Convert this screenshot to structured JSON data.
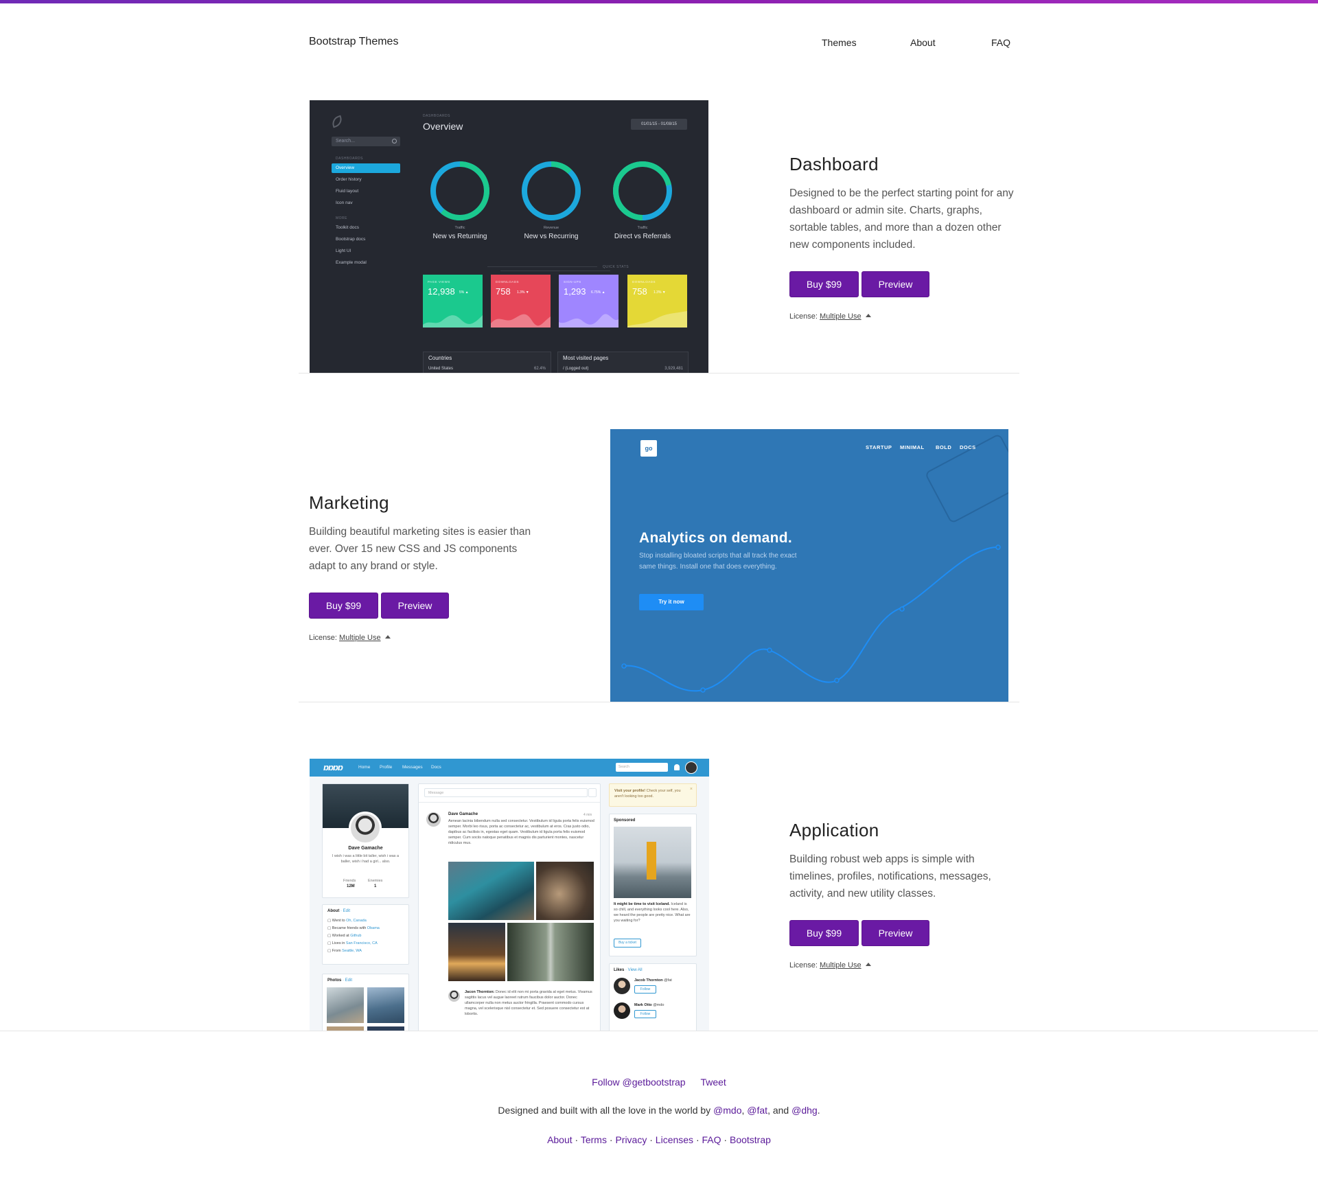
{
  "header": {
    "brand": "Bootstrap Themes",
    "nav": [
      "Themes",
      "About",
      "FAQ"
    ]
  },
  "themes": [
    {
      "name": "Dashboard",
      "description": "Designed to be the perfect starting point for any dashboard or admin site. Charts, graphs, sortable tables, and more than a dozen other new components included.",
      "buy_label": "Buy $99",
      "preview_label": "Preview",
      "license_label": "License:",
      "license_value": "Multiple Use"
    },
    {
      "name": "Marketing",
      "description": "Building beautiful marketing sites is easier than ever. Over 15 new CSS and JS components adapt to any brand or style.",
      "buy_label": "Buy $99",
      "preview_label": "Preview",
      "license_label": "License:",
      "license_value": "Multiple Use"
    },
    {
      "name": "Application",
      "description": "Building robust web apps is simple with timelines, profiles, notifications, messages, activity, and new utility classes.",
      "buy_label": "Buy $99",
      "preview_label": "Preview",
      "license_label": "License:",
      "license_value": "Multiple Use"
    }
  ],
  "dashboard_preview": {
    "search_placeholder": "Search...",
    "section_dashboards": "DASHBOARDS",
    "nav_items": [
      "Overview",
      "Order history",
      "Fluid layout",
      "Icon nav"
    ],
    "section_more": "MORE",
    "more_items": [
      "Toolkit docs",
      "Bootstrap docs",
      "Light UI",
      "Example modal"
    ],
    "label": "DASHBOARDS",
    "title": "Overview",
    "date_range": "01/01/15 - 01/08/15",
    "donuts": [
      {
        "sub": "Traffic",
        "label": "New vs Returning"
      },
      {
        "sub": "Revenue",
        "label": "New vs Recurring"
      },
      {
        "sub": "Traffic",
        "label": "Direct vs Referrals"
      }
    ],
    "quick_stats_label": "QUICK STATS",
    "stats": [
      {
        "label": "PAGE VIEWS",
        "value": "12,938",
        "delta": "5% ▲",
        "color": "#1bc98e"
      },
      {
        "label": "DOWNLOADS",
        "value": "758",
        "delta": "1.3% ▼",
        "color": "#e64759"
      },
      {
        "label": "SIGN-UPS",
        "value": "1,293",
        "delta": "6.75% ▲",
        "color": "#9f86ff"
      },
      {
        "label": "DOWNLOADS",
        "value": "758",
        "delta": "1.3% ▼",
        "color": "#e4d836"
      }
    ],
    "tables": [
      {
        "title": "Countries",
        "row": "United States",
        "value": "62.4%"
      },
      {
        "title": "Most visited pages",
        "row": "/ (Logged out)",
        "value": "3,929,481"
      }
    ]
  },
  "marketing_preview": {
    "logo": "go",
    "nav": [
      "STARTUP",
      "MINIMAL",
      "BOLD",
      "DOCS"
    ],
    "hero_title": "Analytics on demand.",
    "hero_text": "Stop installing bloated scripts that all track the exact same things. Install one that does everything.",
    "cta": "Try it now"
  },
  "app_preview": {
    "nav": [
      "Home",
      "Profile",
      "Messages",
      "Docs"
    ],
    "search_placeholder": "Search",
    "profile_name": "Dave Gamache",
    "profile_bio": "I wish i was a little bit taller, wish i was a baller, wish i had a girl... also.",
    "friends_label": "Friends",
    "friends_value": "12M",
    "enemies_label": "Enemies",
    "enemies_value": "1",
    "about_title": "About",
    "edit_label": "· Edit",
    "about_items": [
      {
        "text": "Went to ",
        "link": "Oh, Canada"
      },
      {
        "text": "Became friends with ",
        "link": "Obama"
      },
      {
        "text": "Worked at ",
        "link": "Github"
      },
      {
        "text": "Lives in ",
        "link": "San Francisco, CA"
      },
      {
        "text": "From ",
        "link": "Seattle, WA"
      }
    ],
    "photos_title": "Photos",
    "message_placeholder": "Message",
    "post_author": "Dave Gamache",
    "post_time": "4 min",
    "post_text": "Aenean lacinia bibendum nulla sed consectetur. Vestibulum id ligula porta felis euismod semper. Morbi leo risus, porta ac consectetur ac, vestibulum at eros. Cras justo odio, dapibus ac facilisis in, egestas eget quam. Vestibulum id ligula porta felis euismod semper. Cum sociis natoque penatibus et magnis dis parturient montes, nascetur ridiculus mus.",
    "comment_author": "Jacon Thornton:",
    "comment_text": "Donec id elit non mi porta gravida at eget metus. Vivamus sagittis lacus vel augue laoreet rutrum faucibus dolor auctor. Donec ullamcorper nulla non metus auctor fringilla. Praesent commodo cursus magna, vel scelerisque nisl consectetur et. Sed posuere consectetur est at lobortis.",
    "alert_bold": "Visit your profile!",
    "alert_text": " Check your self, you aren't looking too good.",
    "sponsored_title": "Sponsored",
    "sponsored_bold": "It might be time to visit Iceland.",
    "sponsored_text": " Iceland is so chill, and everything looks cool here. Also, we heard the people are pretty nice. What are you waiting for?",
    "ticket_label": "Buy a ticket",
    "likes_title": "Likes",
    "view_all": "· View All",
    "likes": [
      {
        "name": "Jacob Thornton",
        "handle": " @fat",
        "follow": "Follow"
      },
      {
        "name": "Mark Otto",
        "handle": " @mdo",
        "follow": "Follow"
      }
    ]
  },
  "footer": {
    "follow": "Follow @getbootstrap",
    "tweet": "Tweet",
    "credit_prefix": "Designed and built with all the love in the world by ",
    "mdo": "@mdo",
    "comma1": ", ",
    "fat": "@fat",
    "and": ", and ",
    "dhg": "@dhg",
    "period": ".",
    "links": [
      "About",
      "Terms",
      "Privacy",
      "Licenses",
      "FAQ",
      "Bootstrap"
    ],
    "separator": " · "
  },
  "colors": {
    "accent": "#6a1aa4",
    "top_bar": "#8a1fb0",
    "dashboard_bg": "#252830",
    "marketing_bg": "#2f77b5",
    "app_bar": "#3097d1"
  }
}
